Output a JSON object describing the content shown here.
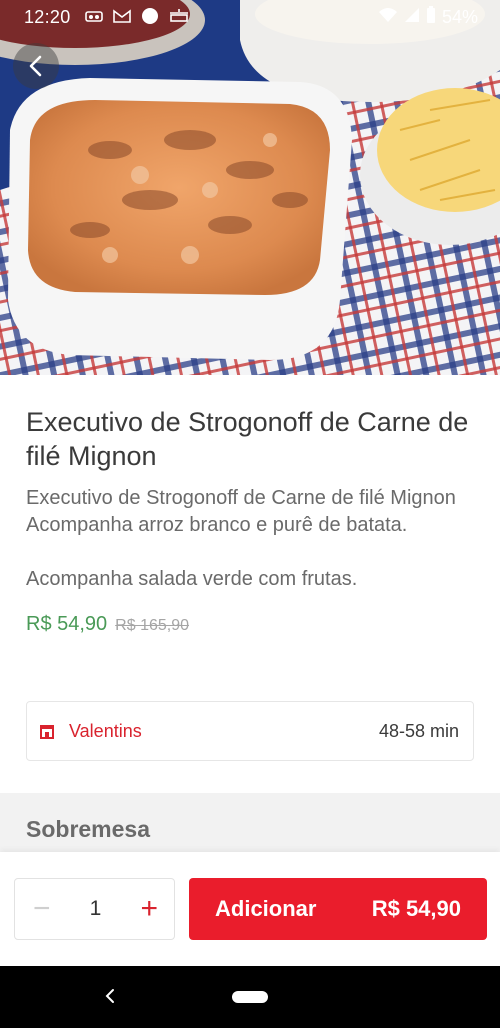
{
  "status_bar": {
    "time": "12:20",
    "battery": "54%",
    "icons": [
      "cast-icon",
      "gmail-icon",
      "circle-icon",
      "cooking-icon",
      "wifi-icon",
      "signal-icon",
      "battery-icon"
    ]
  },
  "product": {
    "title": "Executivo de Strogonoff de Carne de filé Mignon",
    "description": "Executivo de Strogonoff de Carne de filé Mignon\nAcompanha arroz branco e purê de batata.\n\nAcompanha salada verde com frutas.",
    "price": "R$ 54,90",
    "old_price": "R$ 165,90"
  },
  "store": {
    "name": "Valentins",
    "delivery_time": "48-58 min",
    "icon": "store-icon"
  },
  "section": {
    "title": "Sobremesa"
  },
  "action_bar": {
    "quantity": "1",
    "minus_label": "−",
    "plus_label": "+",
    "add_label": "Adicionar",
    "add_price": "R$ 54,90"
  },
  "colors": {
    "brand_red": "#ea1d2c",
    "price_green": "#4a9a57"
  }
}
